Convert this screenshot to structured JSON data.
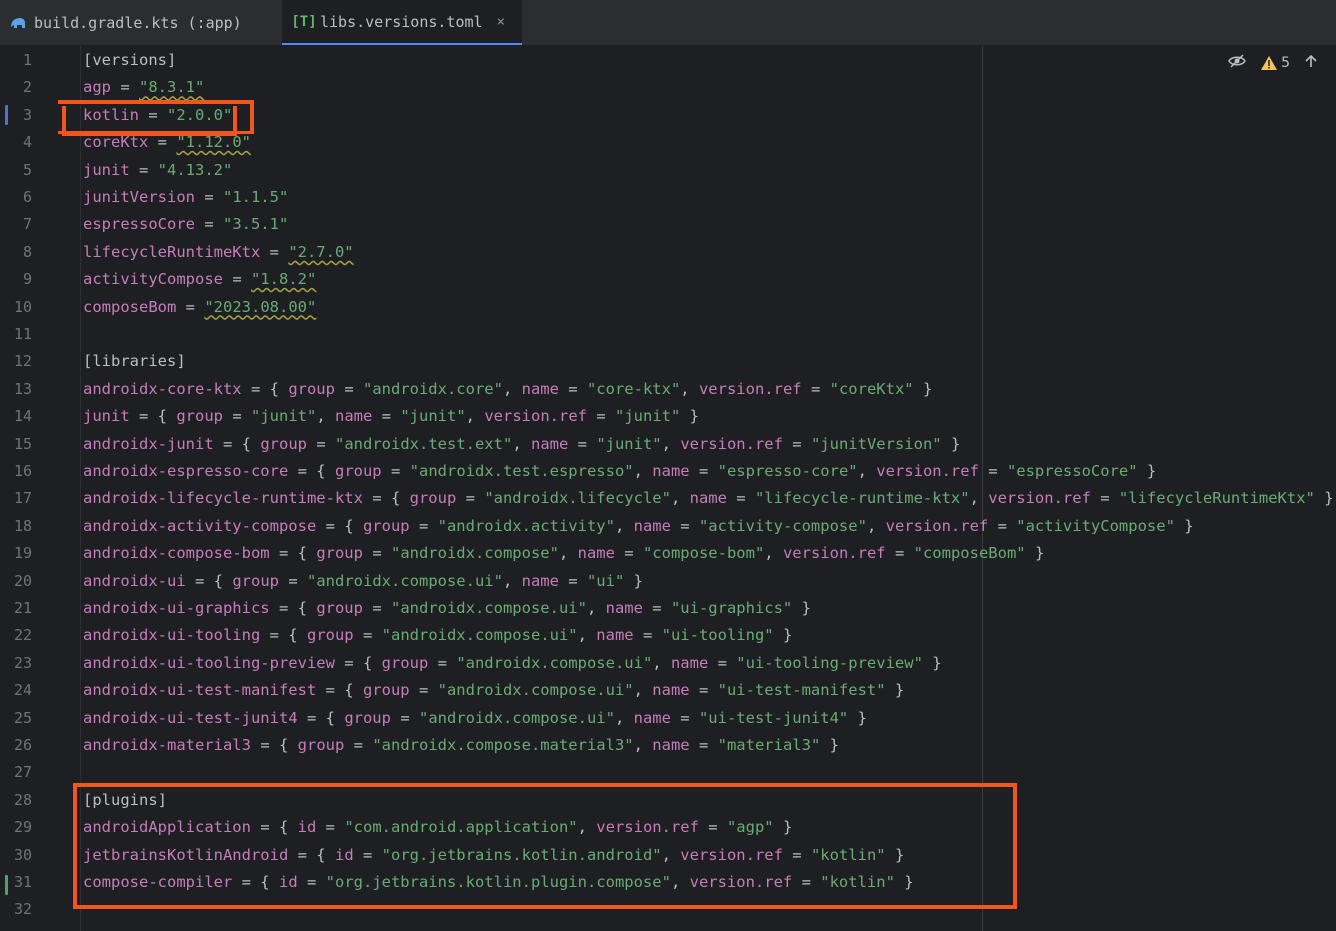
{
  "tabs": [
    {
      "label": "build.gradle.kts (:app)",
      "icon": "gradle-elephant-icon",
      "active": false
    },
    {
      "label": "libs.versions.toml",
      "icon": "toml-file-icon",
      "icon_glyph": "[T]",
      "active": true,
      "close": "×"
    }
  ],
  "inspection": {
    "warning_count": "5",
    "eye_icon": "hidden-eye-icon",
    "warning_icon": "warning-triangle-icon",
    "up_icon": "arrow-up-icon"
  },
  "colors": {
    "accent": "#548af7",
    "annotation": "#f0561d",
    "keyword": "#c77dbb",
    "string": "#6aab73",
    "text": "#bcbec4",
    "background": "#1e1f22"
  },
  "line_numbers": [
    "1",
    "2",
    "3",
    "4",
    "5",
    "6",
    "7",
    "8",
    "9",
    "10",
    "11",
    "12",
    "13",
    "14",
    "15",
    "16",
    "17",
    "18",
    "19",
    "20",
    "21",
    "22",
    "23",
    "24",
    "25",
    "26",
    "27",
    "28",
    "29",
    "30",
    "31",
    "32"
  ],
  "code": [
    [
      [
        "h",
        "[versions]"
      ]
    ],
    [
      [
        "k",
        "agp"
      ],
      [
        "p",
        " = "
      ],
      [
        "sq",
        "\"8.3.1\""
      ]
    ],
    [
      [
        "k",
        "kotlin"
      ],
      [
        "p",
        " = "
      ],
      [
        "s",
        "\"2.0.0\""
      ]
    ],
    [
      [
        "k",
        "coreKtx"
      ],
      [
        "p",
        " = "
      ],
      [
        "sq",
        "\"1.12.0\""
      ]
    ],
    [
      [
        "k",
        "junit"
      ],
      [
        "p",
        " = "
      ],
      [
        "s",
        "\"4.13.2\""
      ]
    ],
    [
      [
        "k",
        "junitVersion"
      ],
      [
        "p",
        " = "
      ],
      [
        "s",
        "\"1.1.5\""
      ]
    ],
    [
      [
        "k",
        "espressoCore"
      ],
      [
        "p",
        " = "
      ],
      [
        "s",
        "\"3.5.1\""
      ]
    ],
    [
      [
        "k",
        "lifecycleRuntimeKtx"
      ],
      [
        "p",
        " = "
      ],
      [
        "sq",
        "\"2.7.0\""
      ]
    ],
    [
      [
        "k",
        "activityCompose"
      ],
      [
        "p",
        " = "
      ],
      [
        "sq",
        "\"1.8.2\""
      ]
    ],
    [
      [
        "k",
        "composeBom"
      ],
      [
        "p",
        " = "
      ],
      [
        "sq",
        "\"2023.08.00\""
      ]
    ],
    [],
    [
      [
        "h",
        "[libraries]"
      ]
    ],
    [
      [
        "k",
        "androidx-core-ktx"
      ],
      [
        "p",
        " = { "
      ],
      [
        "k",
        "group"
      ],
      [
        "p",
        " = "
      ],
      [
        "s",
        "\"androidx.core\""
      ],
      [
        "p",
        ", "
      ],
      [
        "k",
        "name"
      ],
      [
        "p",
        " = "
      ],
      [
        "s",
        "\"core-ktx\""
      ],
      [
        "p",
        ", "
      ],
      [
        "k",
        "version.ref"
      ],
      [
        "p",
        " = "
      ],
      [
        "s",
        "\"coreKtx\""
      ],
      [
        "p",
        " }"
      ]
    ],
    [
      [
        "k",
        "junit"
      ],
      [
        "p",
        " = { "
      ],
      [
        "k",
        "group"
      ],
      [
        "p",
        " = "
      ],
      [
        "s",
        "\"junit\""
      ],
      [
        "p",
        ", "
      ],
      [
        "k",
        "name"
      ],
      [
        "p",
        " = "
      ],
      [
        "s",
        "\"junit\""
      ],
      [
        "p",
        ", "
      ],
      [
        "k",
        "version.ref"
      ],
      [
        "p",
        " = "
      ],
      [
        "s",
        "\"junit\""
      ],
      [
        "p",
        " }"
      ]
    ],
    [
      [
        "k",
        "androidx-junit"
      ],
      [
        "p",
        " = { "
      ],
      [
        "k",
        "group"
      ],
      [
        "p",
        " = "
      ],
      [
        "s",
        "\"androidx.test.ext\""
      ],
      [
        "p",
        ", "
      ],
      [
        "k",
        "name"
      ],
      [
        "p",
        " = "
      ],
      [
        "s",
        "\"junit\""
      ],
      [
        "p",
        ", "
      ],
      [
        "k",
        "version.ref"
      ],
      [
        "p",
        " = "
      ],
      [
        "s",
        "\"junitVersion\""
      ],
      [
        "p",
        " }"
      ]
    ],
    [
      [
        "k",
        "androidx-espresso-core"
      ],
      [
        "p",
        " = { "
      ],
      [
        "k",
        "group"
      ],
      [
        "p",
        " = "
      ],
      [
        "s",
        "\"androidx.test.espresso\""
      ],
      [
        "p",
        ", "
      ],
      [
        "k",
        "name"
      ],
      [
        "p",
        " = "
      ],
      [
        "s",
        "\"espresso-core\""
      ],
      [
        "p",
        ", "
      ],
      [
        "k",
        "version.ref"
      ],
      [
        "p",
        " = "
      ],
      [
        "s",
        "\"espressoCore\""
      ],
      [
        "p",
        " }"
      ]
    ],
    [
      [
        "k",
        "androidx-lifecycle-runtime-ktx"
      ],
      [
        "p",
        " = { "
      ],
      [
        "k",
        "group"
      ],
      [
        "p",
        " = "
      ],
      [
        "s",
        "\"androidx.lifecycle\""
      ],
      [
        "p",
        ", "
      ],
      [
        "k",
        "name"
      ],
      [
        "p",
        " = "
      ],
      [
        "s",
        "\"lifecycle-runtime-ktx\""
      ],
      [
        "p",
        ", "
      ],
      [
        "k",
        "version.ref"
      ],
      [
        "p",
        " = "
      ],
      [
        "s",
        "\"lifecycleRuntimeKtx\""
      ],
      [
        "p",
        " }"
      ]
    ],
    [
      [
        "k",
        "androidx-activity-compose"
      ],
      [
        "p",
        " = { "
      ],
      [
        "k",
        "group"
      ],
      [
        "p",
        " = "
      ],
      [
        "s",
        "\"androidx.activity\""
      ],
      [
        "p",
        ", "
      ],
      [
        "k",
        "name"
      ],
      [
        "p",
        " = "
      ],
      [
        "s",
        "\"activity-compose\""
      ],
      [
        "p",
        ", "
      ],
      [
        "k",
        "version.ref"
      ],
      [
        "p",
        " = "
      ],
      [
        "s",
        "\"activityCompose\""
      ],
      [
        "p",
        " }"
      ]
    ],
    [
      [
        "k",
        "androidx-compose-bom"
      ],
      [
        "p",
        " = { "
      ],
      [
        "k",
        "group"
      ],
      [
        "p",
        " = "
      ],
      [
        "s",
        "\"androidx.compose\""
      ],
      [
        "p",
        ", "
      ],
      [
        "k",
        "name"
      ],
      [
        "p",
        " = "
      ],
      [
        "s",
        "\"compose-bom\""
      ],
      [
        "p",
        ", "
      ],
      [
        "k",
        "version.ref"
      ],
      [
        "p",
        " = "
      ],
      [
        "s",
        "\"composeBom\""
      ],
      [
        "p",
        " }"
      ]
    ],
    [
      [
        "k",
        "androidx-ui"
      ],
      [
        "p",
        " = { "
      ],
      [
        "k",
        "group"
      ],
      [
        "p",
        " = "
      ],
      [
        "s",
        "\"androidx.compose.ui\""
      ],
      [
        "p",
        ", "
      ],
      [
        "k",
        "name"
      ],
      [
        "p",
        " = "
      ],
      [
        "s",
        "\"ui\""
      ],
      [
        "p",
        " }"
      ]
    ],
    [
      [
        "k",
        "androidx-ui-graphics"
      ],
      [
        "p",
        " = { "
      ],
      [
        "k",
        "group"
      ],
      [
        "p",
        " = "
      ],
      [
        "s",
        "\"androidx.compose.ui\""
      ],
      [
        "p",
        ", "
      ],
      [
        "k",
        "name"
      ],
      [
        "p",
        " = "
      ],
      [
        "s",
        "\"ui-graphics\""
      ],
      [
        "p",
        " }"
      ]
    ],
    [
      [
        "k",
        "androidx-ui-tooling"
      ],
      [
        "p",
        " = { "
      ],
      [
        "k",
        "group"
      ],
      [
        "p",
        " = "
      ],
      [
        "s",
        "\"androidx.compose.ui\""
      ],
      [
        "p",
        ", "
      ],
      [
        "k",
        "name"
      ],
      [
        "p",
        " = "
      ],
      [
        "s",
        "\"ui-tooling\""
      ],
      [
        "p",
        " }"
      ]
    ],
    [
      [
        "k",
        "androidx-ui-tooling-preview"
      ],
      [
        "p",
        " = { "
      ],
      [
        "k",
        "group"
      ],
      [
        "p",
        " = "
      ],
      [
        "s",
        "\"androidx.compose.ui\""
      ],
      [
        "p",
        ", "
      ],
      [
        "k",
        "name"
      ],
      [
        "p",
        " = "
      ],
      [
        "s",
        "\"ui-tooling-preview\""
      ],
      [
        "p",
        " }"
      ]
    ],
    [
      [
        "k",
        "androidx-ui-test-manifest"
      ],
      [
        "p",
        " = { "
      ],
      [
        "k",
        "group"
      ],
      [
        "p",
        " = "
      ],
      [
        "s",
        "\"androidx.compose.ui\""
      ],
      [
        "p",
        ", "
      ],
      [
        "k",
        "name"
      ],
      [
        "p",
        " = "
      ],
      [
        "s",
        "\"ui-test-manifest\""
      ],
      [
        "p",
        " }"
      ]
    ],
    [
      [
        "k",
        "androidx-ui-test-junit4"
      ],
      [
        "p",
        " = { "
      ],
      [
        "k",
        "group"
      ],
      [
        "p",
        " = "
      ],
      [
        "s",
        "\"androidx.compose.ui\""
      ],
      [
        "p",
        ", "
      ],
      [
        "k",
        "name"
      ],
      [
        "p",
        " = "
      ],
      [
        "s",
        "\"ui-test-junit4\""
      ],
      [
        "p",
        " }"
      ]
    ],
    [
      [
        "k",
        "androidx-material3"
      ],
      [
        "p",
        " = { "
      ],
      [
        "k",
        "group"
      ],
      [
        "p",
        " = "
      ],
      [
        "s",
        "\"androidx.compose.material3\""
      ],
      [
        "p",
        ", "
      ],
      [
        "k",
        "name"
      ],
      [
        "p",
        " = "
      ],
      [
        "s",
        "\"material3\""
      ],
      [
        "p",
        " }"
      ]
    ],
    [],
    [
      [
        "h",
        "[plugins]"
      ]
    ],
    [
      [
        "k",
        "androidApplication"
      ],
      [
        "p",
        " = { "
      ],
      [
        "k",
        "id"
      ],
      [
        "p",
        " = "
      ],
      [
        "s",
        "\"com.android.application\""
      ],
      [
        "p",
        ", "
      ],
      [
        "k",
        "version.ref"
      ],
      [
        "p",
        " = "
      ],
      [
        "s",
        "\"agp\""
      ],
      [
        "p",
        " }"
      ]
    ],
    [
      [
        "k",
        "jetbrainsKotlinAndroid"
      ],
      [
        "p",
        " = { "
      ],
      [
        "k",
        "id"
      ],
      [
        "p",
        " = "
      ],
      [
        "s",
        "\"org.jetbrains.kotlin.android\""
      ],
      [
        "p",
        ", "
      ],
      [
        "k",
        "version.ref"
      ],
      [
        "p",
        " = "
      ],
      [
        "s",
        "\"kotlin\""
      ],
      [
        "p",
        " }"
      ]
    ],
    [
      [
        "k",
        "compose-compiler"
      ],
      [
        "p",
        " = { "
      ],
      [
        "k",
        "id"
      ],
      [
        "p",
        " = "
      ],
      [
        "s",
        "\"org.jetbrains.kotlin.plugin.compose\""
      ],
      [
        "p",
        ", "
      ],
      [
        "k",
        "version.ref"
      ],
      [
        "p",
        " = "
      ],
      [
        "s",
        "\"kotlin\""
      ],
      [
        "p",
        " }"
      ]
    ],
    []
  ]
}
